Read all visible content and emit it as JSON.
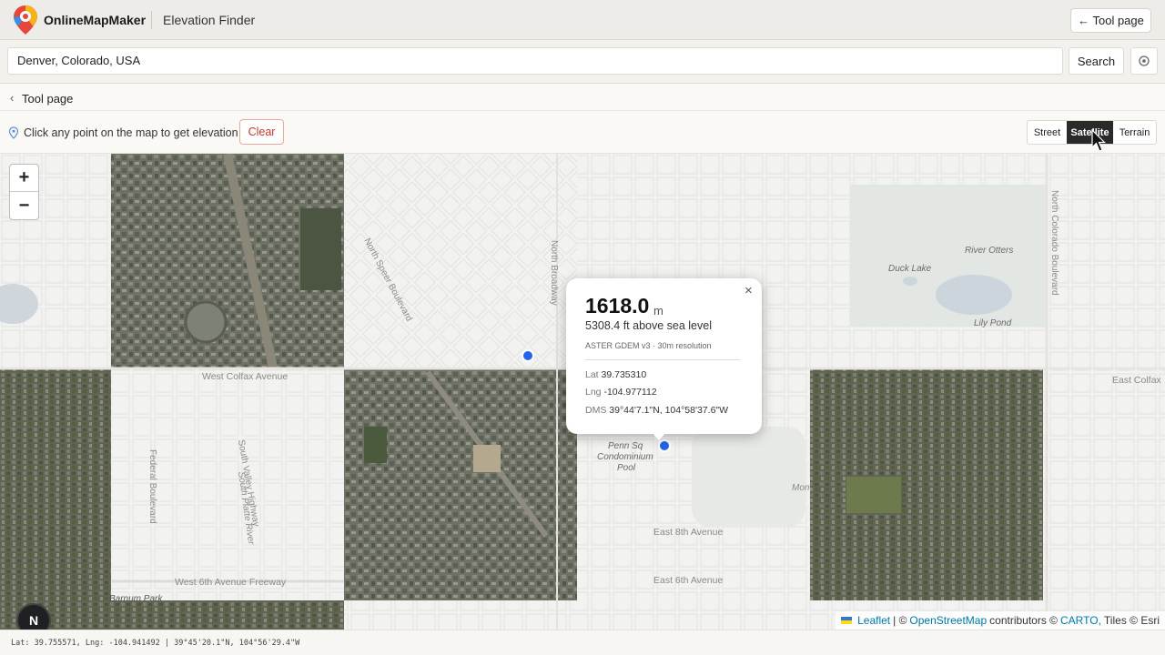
{
  "header": {
    "brand": "OnlineMapMaker",
    "tool_name": "Elevation Finder",
    "tool_page_button": "← Tool page",
    "logo_icon": "map-pin-logo-icon"
  },
  "search": {
    "value": "Denver, Colorado, USA",
    "button_label": "Search",
    "locate_icon": "crosshair-icon"
  },
  "breadcrumb": {
    "chevron": "‹",
    "label": "Tool page"
  },
  "toolbar": {
    "hint": "Click any point on the map to get elevation",
    "hint_icon": "map-pin-icon",
    "clear_label": "Clear",
    "layers": [
      {
        "label": "Street",
        "active": false
      },
      {
        "label": "Satellite",
        "active": true
      },
      {
        "label": "Terrain",
        "active": false
      }
    ]
  },
  "map": {
    "zoom_in": "+",
    "zoom_out": "−",
    "north_label": "N",
    "street_labels": [
      "West Colfax Avenue",
      "North Speer Boulevard",
      "North Broadway",
      "South Valley Highway",
      "Federal Boulevard",
      "South Platte River",
      "West 6th Avenue Freeway",
      "East 8th Avenue",
      "East 6th Avenue",
      "North Colorado Boulevard",
      "East Colfax",
      "Barnum Park",
      "Mon"
    ],
    "place_labels": [
      "Duck Lake",
      "River Otters",
      "Lily Pond",
      "Penn Sq Condominium Pool"
    ],
    "attribution": {
      "leaflet": "Leaflet",
      "sep1": "| ©",
      "osm": "OpenStreetMap",
      "contrib": "contributors ©",
      "carto": "CARTO,",
      "tiles": "Tiles © Esri"
    }
  },
  "popup": {
    "elevation_m": "1618.0",
    "unit": "m",
    "elevation_ft": "5308.4 ft above sea level",
    "source": "ASTER GDEM v3 · 30m resolution",
    "lat_key": "Lat",
    "lat": "39.735310",
    "lng_key": "Lng",
    "lng": "-104.977112",
    "dms_key": "DMS",
    "dms": "39°44'7.1\"N, 104°58'37.6\"W",
    "close": "×"
  },
  "status": {
    "text": "Lat: 39.755571, Lng: -104.941492 | 39°45'20.1\"N, 104°56'29.4\"W"
  },
  "colors": {
    "accent_dark": "#2a2a2a",
    "clear_red": "#c0392b",
    "marker_blue": "#2563eb",
    "link_blue": "#0078a8"
  }
}
